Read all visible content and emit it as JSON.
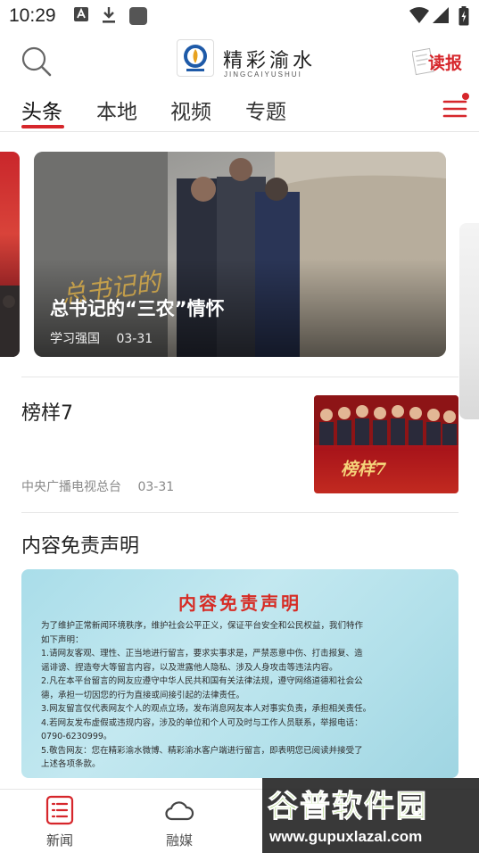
{
  "status_bar": {
    "time": "10:29"
  },
  "header": {
    "brand_name": "精彩渝水",
    "brand_subtitle": "JINGCAIYUSHUI",
    "read_paper_label": "读报"
  },
  "tabs": [
    {
      "label": "头条",
      "active": true
    },
    {
      "label": "本地",
      "active": false
    },
    {
      "label": "视频",
      "active": false
    },
    {
      "label": "专题",
      "active": false
    }
  ],
  "carousel": {
    "current": {
      "title": "总书记的“三农”情怀",
      "source": "学习强国",
      "date": "03-31",
      "overlay_text": "总书记的"
    }
  },
  "news_list": [
    {
      "title": "榜样7",
      "source": "中央广播电视总台",
      "date": "03-31",
      "thumb_text": "榜样7"
    }
  ],
  "disclaimer_section": {
    "title": "内容免责声明",
    "image_heading": "内容免责声明",
    "image_lines": [
      "为了维护正常新闻环境秩序，维护社会公平正义，保证平台安全和公民权益，我们特作",
      "如下声明：",
      "1.请网友客观、理性、正当地进行留言，要求实事求是，严禁恶意中伤、打击报复、造",
      "谣诽谤、捏造夸大等留言内容，以及泄露他人隐私、涉及人身攻击等违法内容。",
      "2.凡在本平台留言的网友应遵守中华人民共和国有关法律法规，遵守网络道德和社会公",
      "德，承担一切因您的行为直接或间接引起的法律责任。",
      "3.网友留言仅代表网友个人的观点立场，发布消息网友本人对事实负责，承担相关责任。",
      "4.若网友发布虚假或违规内容，涉及的单位和个人可及时与工作人员联系，举报电话：",
      "0790-6230999。",
      "5.敬告网友：您在精彩渝水微博、精彩渝水客户端进行留言，即表明您已阅读并接受了",
      "上述各项条款。"
    ]
  },
  "bottom_nav": [
    {
      "label": "新闻",
      "icon": "news-list-icon",
      "active": true
    },
    {
      "label": "融媒",
      "icon": "cloud-icon",
      "active": false
    }
  ],
  "watermark": {
    "title": "谷普软件园",
    "url": "www.gupuxlazal.com"
  },
  "colors": {
    "accent": "#d6262b",
    "divider": "#e6e6e6"
  }
}
